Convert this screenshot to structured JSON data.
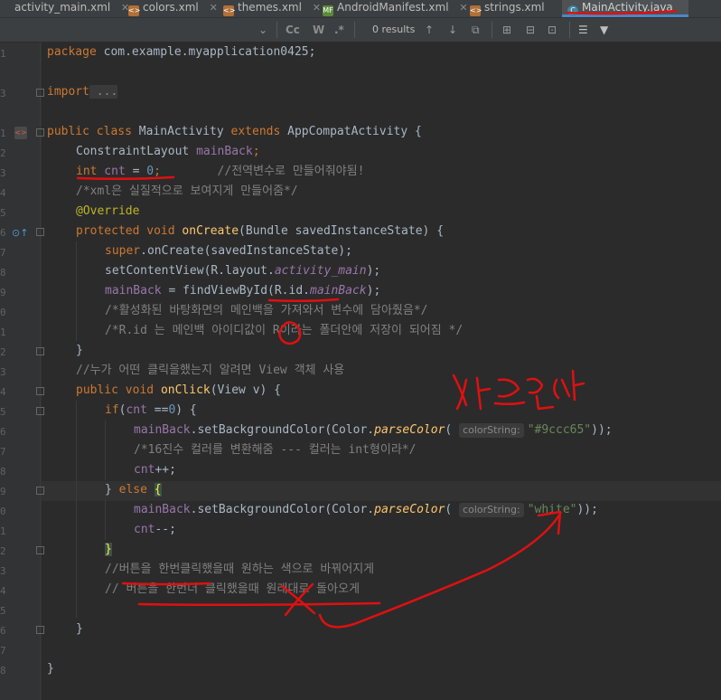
{
  "tabs": [
    {
      "label": "activity_main.xml",
      "icon": "xml-file-icon"
    },
    {
      "label": "colors.xml",
      "icon": "xml-file-icon"
    },
    {
      "label": "themes.xml",
      "icon": "xml-file-icon"
    },
    {
      "label": "AndroidManifest.xml",
      "icon": "manifest-file-icon"
    },
    {
      "label": "strings.xml",
      "icon": "xml-file-icon"
    },
    {
      "label": "MainActivity.java",
      "icon": "java-class-icon",
      "active": true
    }
  ],
  "search": {
    "results": "0 results",
    "match_case": "Cc",
    "words": "W",
    "regex": ".*"
  },
  "line_numbers": [
    "1",
    "",
    "3",
    "",
    "1",
    "2",
    "3",
    "4",
    "5",
    "6",
    "7",
    "8",
    "9",
    "0",
    "1",
    "2",
    "3",
    "4",
    "5",
    "6",
    "7",
    "8",
    "9",
    "0",
    "1",
    "2",
    "3",
    "4",
    "5",
    "6",
    "7",
    "8"
  ],
  "code": {
    "l1_kw": "package",
    "l1_rest": " com.example.myapplication0425;",
    "l3_kw": "import",
    "l3_rest": " ...",
    "l5_public": "public",
    "l5_class": "class",
    "l5_name": " MainActivity ",
    "l5_extends": "extends",
    "l5_rest": " AppCompatActivity {",
    "l6_type": "ConstraintLayout ",
    "l6_field": "mainBack",
    "l6_end": ";",
    "l7_int": "int",
    "l7_field": " cnt",
    "l7_eq": " = ",
    "l7_num": "0",
    "l7_end": ";",
    "l7_cmt": "        //전역변수로 만들어줘야됨!",
    "l8_cmt": "/*xml은 실질적으로 보여지게 만들어줌*/",
    "l9_ann": "@Override",
    "l10_protected": "protected",
    "l10_void": " void ",
    "l10_fn": "onCreate",
    "l10_rest": "(Bundle savedInstanceState) {",
    "l11_super": "super",
    "l11_rest": ".onCreate(savedInstanceState);",
    "l12_a": "setContentView(R.layout.",
    "l12_field": "activity_main",
    "l12_b": ");",
    "l13_field": "mainBack",
    "l13_a": " = findViewById(R.id.",
    "l13_field2": "mainBack",
    "l13_b": ");",
    "l14_cmt": "/*활성화된 바탕화면의 메인백을 가져와서 변수에 담아줬음*/",
    "l15_cmt": "/*R.id 는 메인백 아이디값이 R이라는 폴더안에 저장이 되어짐 */",
    "l16": "}",
    "l17_cmt": "//누가 어떤 클릭을했는지 알려면 View 객체 사용",
    "l18_public": "public",
    "l18_void": " void ",
    "l18_fn": "onClick",
    "l18_rest": "(View v) {",
    "l19_if": "if",
    "l19_a": "(",
    "l19_field": "cnt",
    "l19_b": " ==",
    "l19_num": "0",
    "l19_c": ") {",
    "l20_field": "mainBack",
    "l20_a": ".setBackgroundColor(Color.",
    "l20_fn": "parseColor",
    "l20_b": "( ",
    "l20_hint": "colorString:",
    "l20_str": "\"#9ccc65\"",
    "l20_c": "));",
    "l21_cmt": "/*16진수 컬러를 변환해줌 --- 컬러는 int형이라*/",
    "l22_field": "cnt",
    "l22_a": "++;",
    "l23_a": "} ",
    "l23_else": "else",
    "l23_brace": "{",
    "l24_field": "mainBack",
    "l24_a": ".setBackgroundColor(Color.",
    "l24_fn": "parseColor",
    "l24_b": "( ",
    "l24_hint": "colorString:",
    "l24_str": "\"white\"",
    "l24_c": "));",
    "l25_field": "cnt",
    "l25_a": "--;",
    "l26_brace": "}",
    "l27_cmt": "//버튼을 한번클릭했을때 원하는 색으로 바꿔어지게",
    "l28_cmt": "// 버튼을 한번더 클릭했을때 원래대로 돌아오게",
    "l30": "}",
    "l32": "}"
  },
  "colors": {
    "background": "#2b2b2b",
    "keyword": "#cc7832",
    "field": "#9876aa",
    "method": "#ffc66d",
    "string": "#6a8759",
    "comment": "#808080",
    "annotation": "#bbb529",
    "ink": "#e01010"
  }
}
